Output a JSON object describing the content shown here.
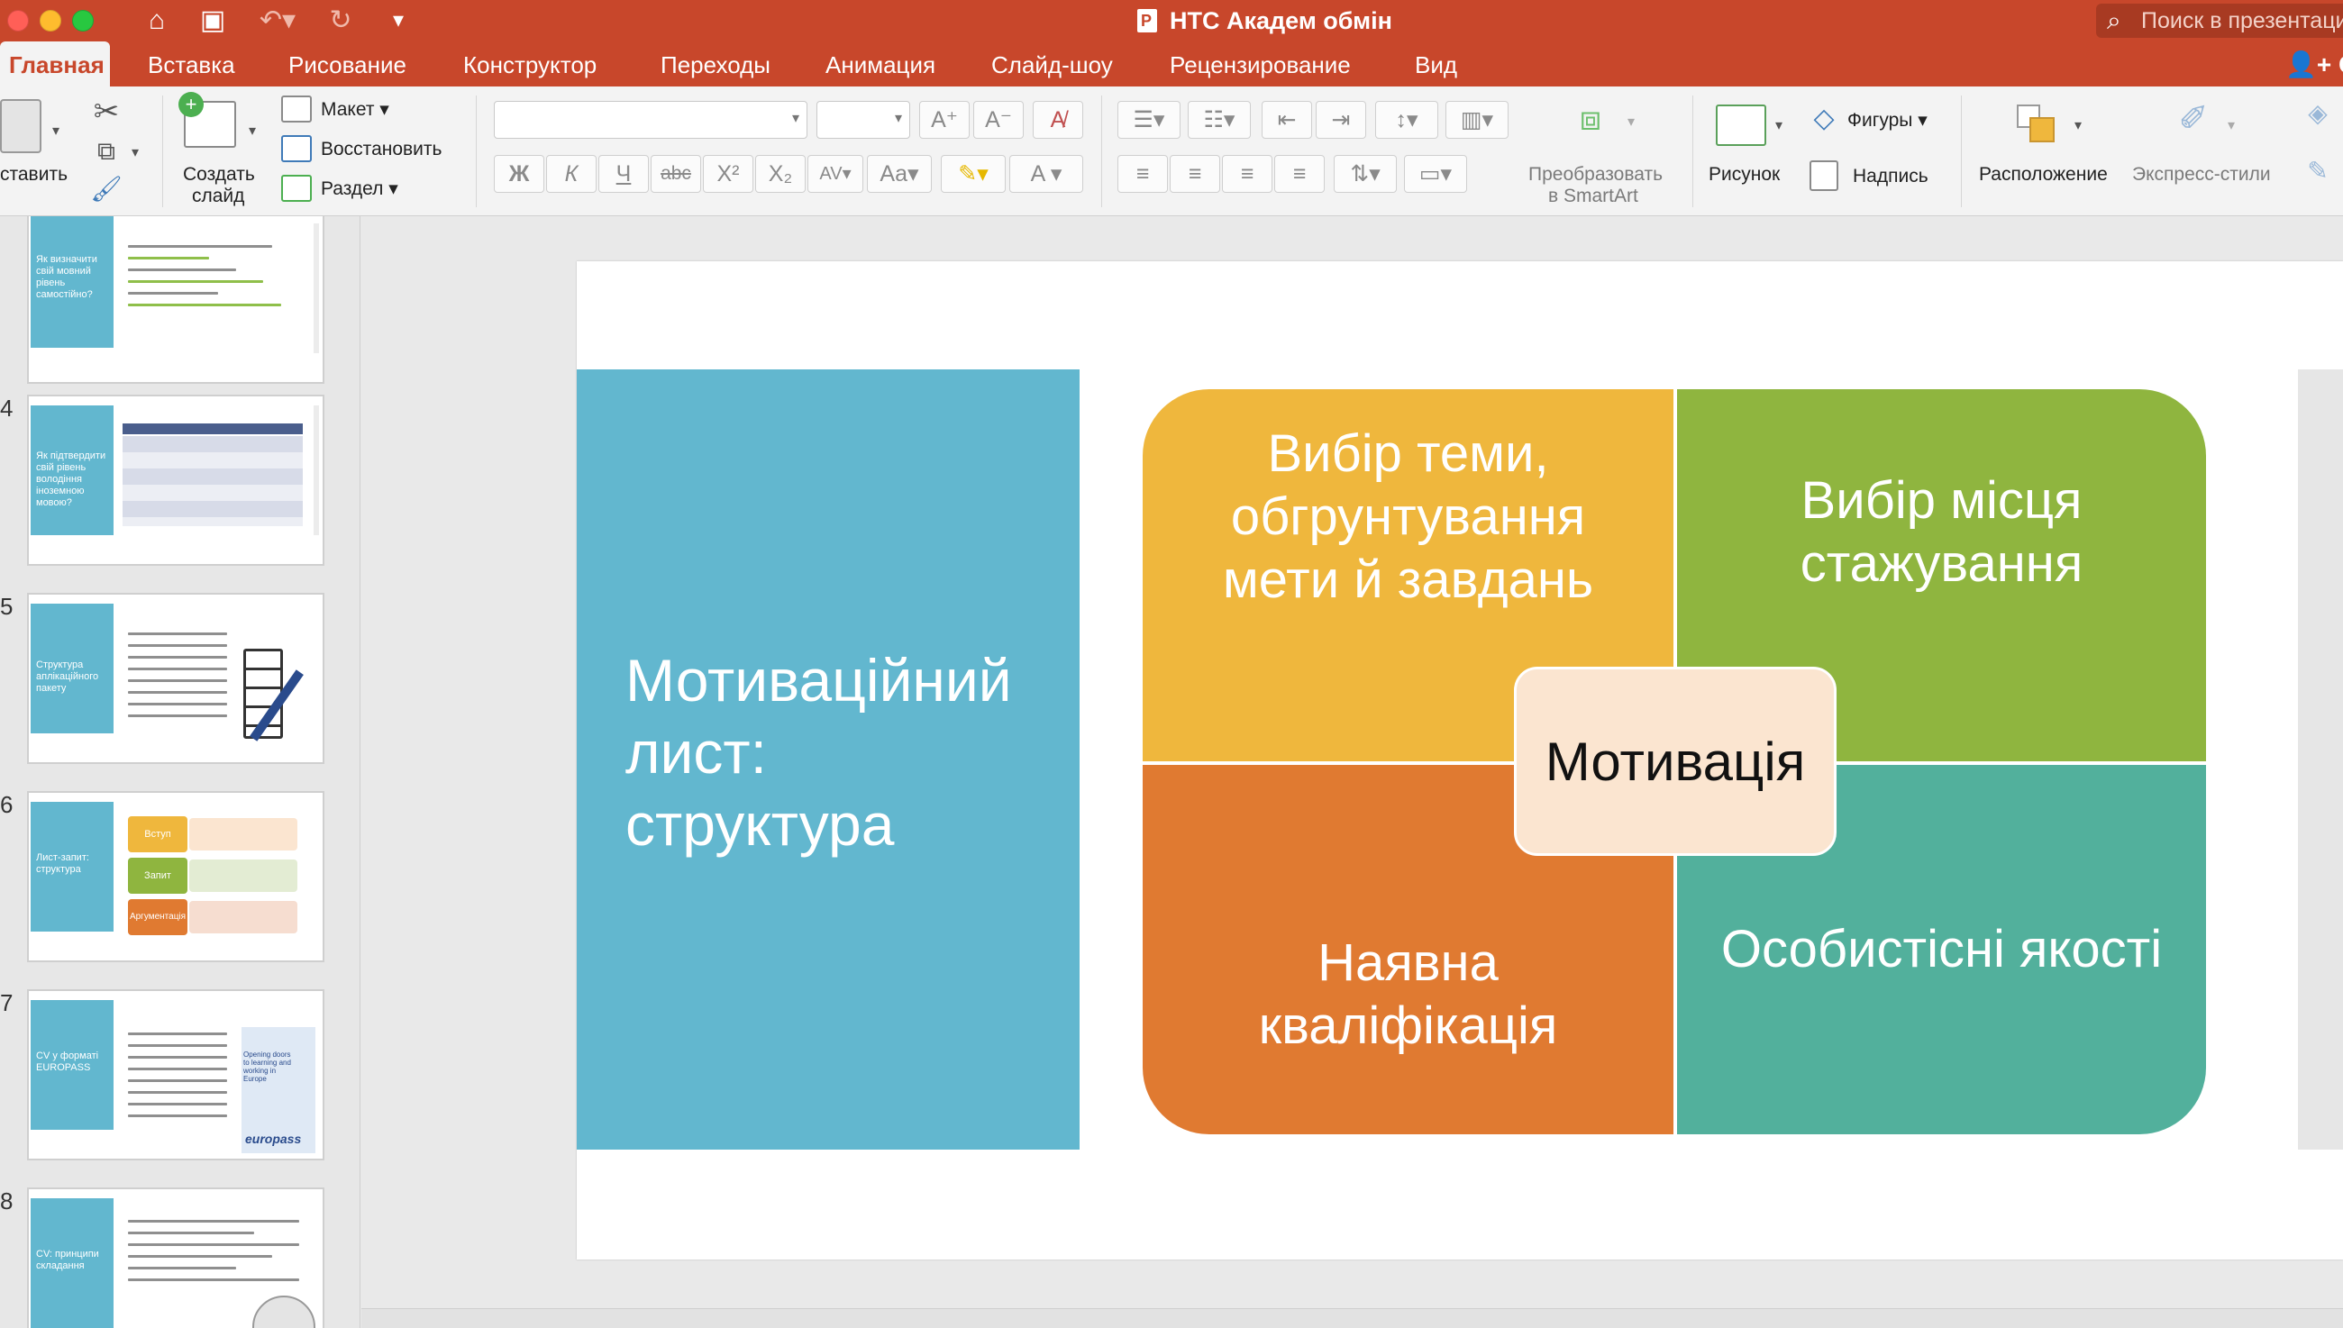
{
  "window": {
    "title": "НТС Академ обмін",
    "search_placeholder": "Поиск в презентации"
  },
  "tabs": [
    {
      "label": "Главная"
    },
    {
      "label": "Вставка"
    },
    {
      "label": "Рисование"
    },
    {
      "label": "Конструктор"
    },
    {
      "label": "Переходы"
    },
    {
      "label": "Анимация"
    },
    {
      "label": "Слайд-шоу"
    },
    {
      "label": "Рецензирование"
    },
    {
      "label": "Вид"
    }
  ],
  "share_label": "О",
  "ribbon": {
    "paste": "ставить",
    "new_slide_line1": "Создать",
    "new_slide_line2": "слайд",
    "layout": "Макет",
    "reset": "Восстановить",
    "section": "Раздел",
    "smartart_line1": "Преобразовать",
    "smartart_line2": "в SmartArt",
    "picture": "Рисунок",
    "shapes": "Фигуры",
    "textbox": "Надпись",
    "arrange": "Расположение",
    "quick_styles": "Экспресс-стили"
  },
  "thumbnails": [
    {
      "num": "",
      "title": "Як визначити свій мовний рівень самостійно?"
    },
    {
      "num": "4",
      "title": "Як підтвердити свій рівень володіння іноземною мовою?"
    },
    {
      "num": "5",
      "title": "Структура аплікаційного пакету"
    },
    {
      "num": "6",
      "title": "Лист-запит: структура"
    },
    {
      "num": "7",
      "title": "CV у форматі EUROPASS"
    },
    {
      "num": "8",
      "title": "CV: принципи складання"
    }
  ],
  "thumb6_labels": {
    "a": "Вступ",
    "b": "Запит",
    "c": "Аргументація"
  },
  "thumb7_labels": {
    "logo": "europass",
    "caption": "Opening doors to learning and working in Europe"
  },
  "slide": {
    "title": "Мотиваційний лист: структура",
    "q1": "Вибір теми, обгрунтування мети й завдань",
    "q2": "Вибір місця стажування",
    "q3": "Наявна кваліфікація",
    "q4": "Особистісні якості",
    "center": "Мотивація"
  },
  "colors": {
    "accent": "#c8472b",
    "slide_blue": "#62b7cf",
    "q1": "#efb73d",
    "q2": "#8fb53f",
    "q3": "#e07a31",
    "q4": "#52b09c",
    "center": "#fbe5d0"
  }
}
